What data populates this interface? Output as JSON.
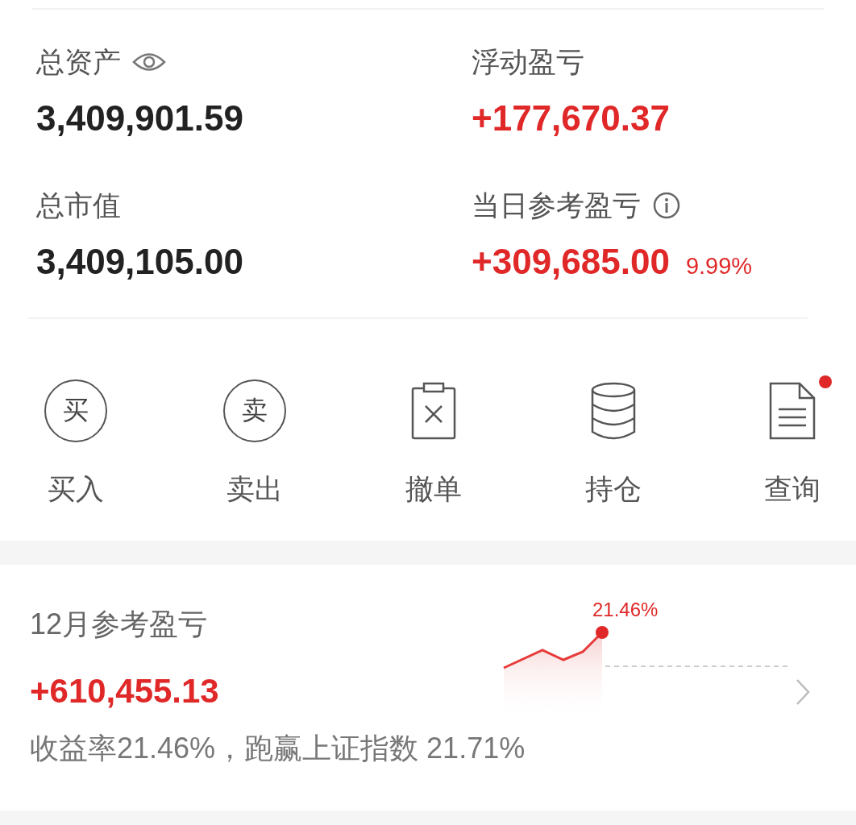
{
  "stats": [
    {
      "label": "总资产",
      "value": "3,409,901.59",
      "positive": false
    },
    {
      "label": "浮动盈亏",
      "value": "+177,670.37",
      "positive": true
    },
    {
      "label": "总市值",
      "value": "3,409,105.00",
      "positive": false
    },
    {
      "label": "当日参考盈亏",
      "value": "+309,685.00",
      "percent": "9.99%",
      "positive": true
    }
  ],
  "actions": [
    {
      "kind": "glyph",
      "glyph": "买",
      "label": "买入",
      "badge": false
    },
    {
      "kind": "glyph",
      "glyph": "卖",
      "label": "卖出",
      "badge": false
    },
    {
      "kind": "cancel",
      "label": "撤单",
      "badge": false
    },
    {
      "kind": "stack",
      "label": "持仓",
      "badge": false
    },
    {
      "kind": "document",
      "label": "查询",
      "badge": true
    }
  ],
  "monthly": {
    "title": "12月参考盈亏",
    "value": "+610,455.13",
    "summary": "收益率21.46%，跑赢上证指数 21.71%",
    "peak_label": "21.46%"
  }
}
